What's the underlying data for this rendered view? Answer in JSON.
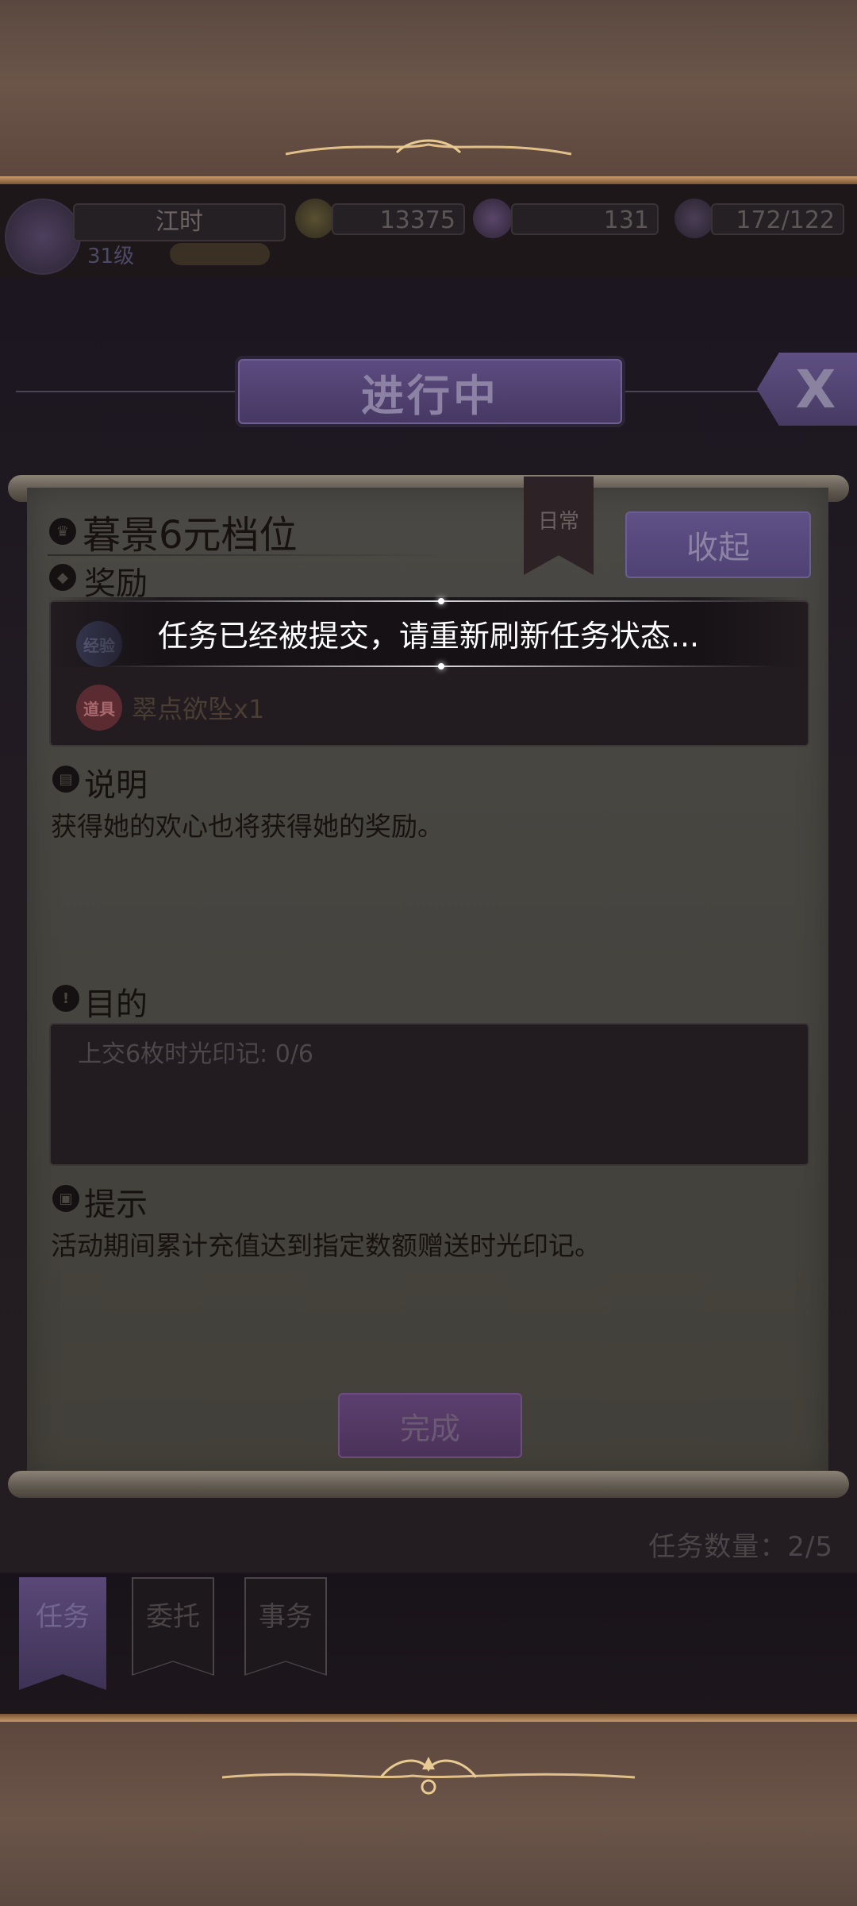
{
  "header": {
    "player_name": "江时",
    "level": "31级",
    "resources": [
      {
        "icon": "gold-coin-icon",
        "value": "13375"
      },
      {
        "icon": "purple-gem-icon",
        "value": "131"
      },
      {
        "icon": "stamina-icon",
        "value": "172/122"
      }
    ]
  },
  "panel": {
    "title": "进行中",
    "close_label": "X"
  },
  "task": {
    "name": "暮景6元档位",
    "tag": "日常",
    "collapse_label": "收起",
    "rewards_label": "奖励",
    "rewards": [
      {
        "badge": "经验",
        "text": ""
      },
      {
        "badge": "道具",
        "text": "翠点欲坠x1"
      }
    ],
    "description_label": "说明",
    "description": "获得她的欢心也将获得她的奖励。",
    "goal_label": "目的",
    "goal": "上交6枚时光印记: 0/6",
    "hint_label": "提示",
    "hint": "活动期间累计充值达到指定数额赠送时光印记。",
    "complete_label": "完成"
  },
  "task_count": "任务数量：2/5",
  "tabs": [
    {
      "label": "任务",
      "active": true
    },
    {
      "label": "委托",
      "active": false
    },
    {
      "label": "事务",
      "active": false
    }
  ],
  "toast": "任务已经被提交，请重新刷新任务状态..."
}
